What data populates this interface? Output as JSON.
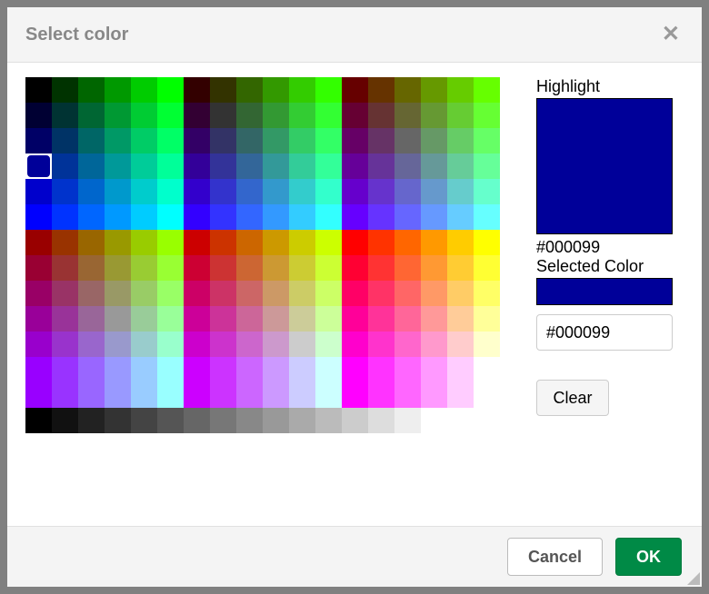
{
  "dialog": {
    "title": "Select color"
  },
  "highlight": {
    "label": "Highlight",
    "color": "#000099",
    "hex_label": "#000099"
  },
  "selected": {
    "label": "Selected Color",
    "color": "#000099"
  },
  "hex_input": {
    "value": "#000099"
  },
  "buttons": {
    "clear": "Clear",
    "cancel": "Cancel",
    "ok": "OK"
  },
  "palette": {
    "selected_index": 54,
    "main": [
      "#000000",
      "#003300",
      "#006600",
      "#009900",
      "#00cc00",
      "#00ff00",
      "#330000",
      "#333300",
      "#336600",
      "#339900",
      "#33cc00",
      "#33ff00",
      "#660000",
      "#663300",
      "#666600",
      "#669900",
      "#66cc00",
      "#66ff00",
      "#000033",
      "#003333",
      "#006633",
      "#009933",
      "#00cc33",
      "#00ff33",
      "#330033",
      "#333333",
      "#336633",
      "#339933",
      "#33cc33",
      "#33ff33",
      "#660033",
      "#663333",
      "#666633",
      "#669933",
      "#66cc33",
      "#66ff33",
      "#000066",
      "#003366",
      "#006666",
      "#009966",
      "#00cc66",
      "#00ff66",
      "#330066",
      "#333366",
      "#336666",
      "#339966",
      "#33cc66",
      "#33ff66",
      "#660066",
      "#663366",
      "#666666",
      "#669966",
      "#66cc66",
      "#66ff66",
      "#000099",
      "#003399",
      "#006699",
      "#009999",
      "#00cc99",
      "#00ff99",
      "#330099",
      "#333399",
      "#336699",
      "#339999",
      "#33cc99",
      "#33ff99",
      "#660099",
      "#663399",
      "#666699",
      "#669999",
      "#66cc99",
      "#66ff99",
      "#0000cc",
      "#0033cc",
      "#0066cc",
      "#0099cc",
      "#00cccc",
      "#00ffcc",
      "#3300cc",
      "#3333cc",
      "#3366cc",
      "#3399cc",
      "#33cccc",
      "#33ffcc",
      "#6600cc",
      "#6633cc",
      "#6666cc",
      "#6699cc",
      "#66cccc",
      "#66ffcc",
      "#0000ff",
      "#0033ff",
      "#0066ff",
      "#0099ff",
      "#00ccff",
      "#00ffff",
      "#3300ff",
      "#3333ff",
      "#3366ff",
      "#3399ff",
      "#33ccff",
      "#33ffff",
      "#6600ff",
      "#6633ff",
      "#6666ff",
      "#6699ff",
      "#66ccff",
      "#66ffff",
      "#990000",
      "#993300",
      "#996600",
      "#999900",
      "#99cc00",
      "#99ff00",
      "#cc0000",
      "#cc3300",
      "#cc6600",
      "#cc9900",
      "#cccc00",
      "#ccff00",
      "#ff0000",
      "#ff3300",
      "#ff6600",
      "#ff9900",
      "#ffcc00",
      "#ffff00",
      "#990033",
      "#993333",
      "#996633",
      "#999933",
      "#99cc33",
      "#99ff33",
      "#cc0033",
      "#cc3333",
      "#cc6633",
      "#cc9933",
      "#cccc33",
      "#ccff33",
      "#ff0033",
      "#ff3333",
      "#ff6633",
      "#ff9933",
      "#ffcc33",
      "#ffff33",
      "#990066",
      "#993366",
      "#996666",
      "#999966",
      "#99cc66",
      "#99ff66",
      "#cc0066",
      "#cc3366",
      "#cc6666",
      "#cc9966",
      "#cccc66",
      "#ccff66",
      "#ff0066",
      "#ff3366",
      "#ff6666",
      "#ff9966",
      "#ffcc66",
      "#ffff66",
      "#990099",
      "#993399",
      "#996699",
      "#999999",
      "#99cc99",
      "#99ff99",
      "#cc0099",
      "#cc3399",
      "#cc6699",
      "#cc9999",
      "#cccc99",
      "#ccff99",
      "#ff0099",
      "#ff3399",
      "#ff6699",
      "#ff9999",
      "#ffcc99",
      "#ffff99",
      "#9900cc",
      "#9933cc",
      "#9966cc",
      "#9999cc",
      "#99cccc",
      "#99ffcc",
      "#cc00cc",
      "#cc33cc",
      "#cc66cc",
      "#cc99cc",
      "#cccccc",
      "#ccffcc",
      "#ff00cc",
      "#ff33cc",
      "#ff66cc",
      "#ff99cc",
      "#ffcccc",
      "#ffffcc",
      "#9900ff",
      "#9933ff",
      "#9966ff",
      "#9999ff",
      "#99ccff",
      "#99ffff",
      "#cc00ff",
      "#cc33ff",
      "#cc66ff",
      "#cc99ff",
      "#ccccff",
      "#ccffff",
      "#ff00ff",
      "#ff33ff",
      "#ff66ff",
      "#ff99ff",
      "#ffccff",
      "#ffffff",
      "#9900ff",
      "#9933ff",
      "#9966ff",
      "#9999ff",
      "#99ccff",
      "#99ffff",
      "#cc00ff",
      "#cc33ff",
      "#cc66ff",
      "#cc99ff",
      "#ccccff",
      "#ccffff",
      "#ff00ff",
      "#ff33ff",
      "#ff66ff",
      "#ff99ff",
      "#ffccff",
      "#ffffff",
      "#000000",
      "#111111",
      "#222222",
      "#333333",
      "#444444",
      "#555555",
      "#666666",
      "#777777",
      "#888888",
      "#999999",
      "#aaaaaa",
      "#bbbbbb",
      "#cccccc",
      "#dddddd",
      "#eeeeee",
      "#ffffff",
      "#ffffff",
      "#ffffff"
    ]
  }
}
